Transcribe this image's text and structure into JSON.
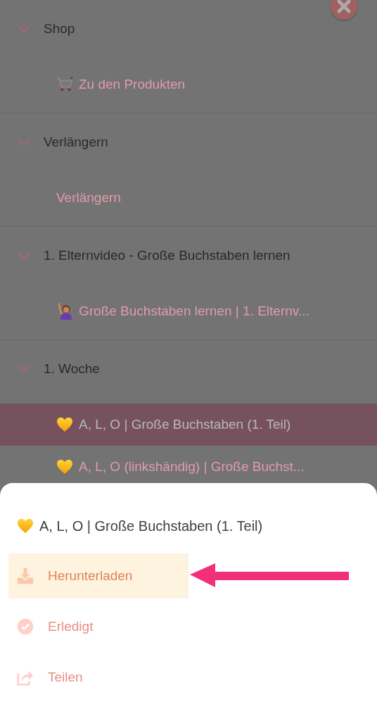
{
  "sections": [
    {
      "title": "Shop",
      "expanded": true,
      "items": [
        {
          "label": "Zu den Produkten",
          "kind": "cart",
          "selected": false
        }
      ]
    },
    {
      "title": "Verlängern",
      "expanded": true,
      "items": [
        {
          "label": "Verlängern",
          "kind": "plain",
          "selected": false
        }
      ]
    },
    {
      "title": "1. Elternvideo - Große Buchstaben lernen",
      "expanded": true,
      "items": [
        {
          "label": "Große Buchstaben lernen | 1. Elternv...",
          "kind": "person",
          "selected": false
        }
      ]
    },
    {
      "title": "1. Woche",
      "expanded": true,
      "items": [
        {
          "label": "A, L, O | Große Buchstaben (1. Teil)",
          "kind": "heart",
          "selected": true
        },
        {
          "label": "A, L, O (linkshändig) | Große Buchst...",
          "kind": "heart",
          "selected": false
        }
      ]
    }
  ],
  "sheet": {
    "title": "A, L, O | Große Buchstaben (1. Teil)",
    "actions": [
      {
        "kind": "download",
        "label": "Herunterladen",
        "highlighted": true
      },
      {
        "kind": "done",
        "label": "Erledigt",
        "highlighted": false
      },
      {
        "kind": "share",
        "label": "Teilen",
        "highlighted": false
      }
    ]
  }
}
